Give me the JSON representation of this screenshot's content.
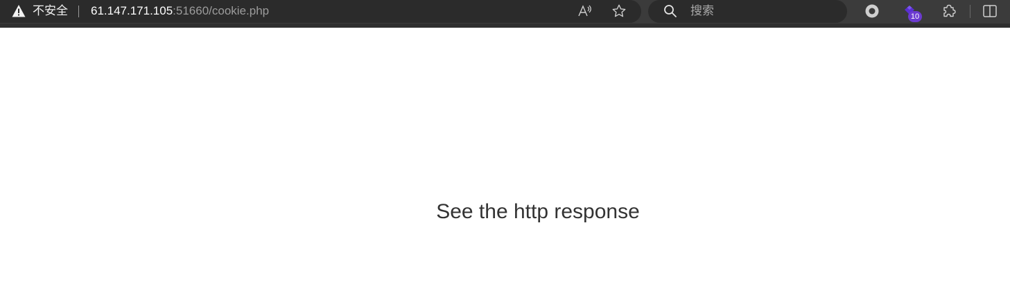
{
  "browser": {
    "security_label": "不安全",
    "url_host": "61.147.171.105",
    "url_rest": ":51660/cookie.php",
    "search_placeholder": "搜索",
    "extension_badge_count": "10",
    "icons": {
      "security": "warning-triangle-icon",
      "read_aloud": "read-aloud-icon",
      "favorite": "star-icon",
      "search": "search-icon",
      "record": "circle-record-icon",
      "extension": "extension-icon",
      "puzzle": "puzzle-icon",
      "split": "split-screen-icon"
    },
    "colors": {
      "toolbar": "#3b3b3b",
      "field": "#2b2b2b",
      "badge": "#6c3bd0"
    }
  },
  "page": {
    "message": "See the http response"
  }
}
